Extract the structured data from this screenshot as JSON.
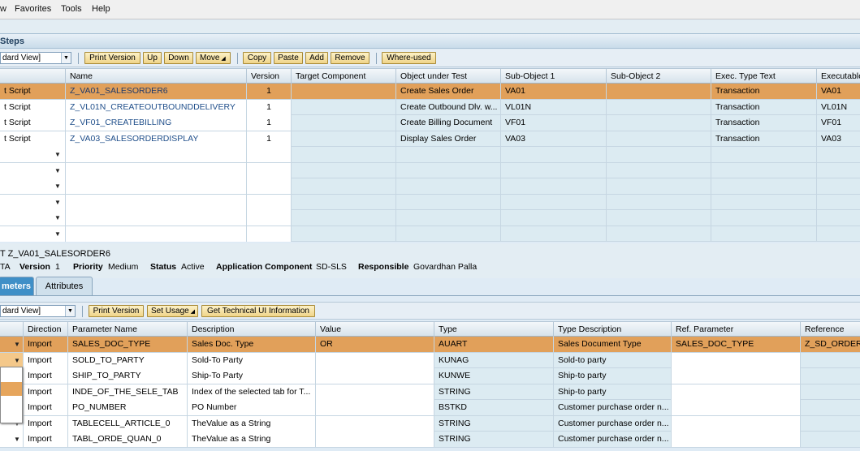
{
  "menu": [
    "w",
    "Favorites",
    "Tools",
    "Help"
  ],
  "top_section": {
    "title": "Steps",
    "layout_select": "dard View]",
    "buttons": [
      "Print Version",
      "Up",
      "Down",
      "Move",
      "Copy",
      "Paste",
      "Add",
      "Remove",
      "Where-used"
    ],
    "columns": [
      "",
      "Name",
      "Version",
      "Target Component",
      "Object under Test",
      "Sub-Object 1",
      "Sub-Object 2",
      "Exec. Type Text",
      "Executable"
    ],
    "rows": [
      {
        "type": "t Script",
        "name": "Z_VA01_SALESORDER6",
        "version": "1",
        "target": "",
        "object": "Create Sales Order",
        "sub1": "VA01",
        "sub2": "",
        "exec": "Transaction",
        "executable": "VA01"
      },
      {
        "type": "t Script",
        "name": "Z_VL01N_CREATEOUTBOUNDDELIVERY",
        "version": "1",
        "target": "",
        "object": "Create Outbound Dlv. w...",
        "sub1": "VL01N",
        "sub2": "",
        "exec": "Transaction",
        "executable": "VL01N"
      },
      {
        "type": "t Script",
        "name": "Z_VF01_CREATEBILLING",
        "version": "1",
        "target": "",
        "object": "Create Billing Document",
        "sub1": "VF01",
        "sub2": "",
        "exec": "Transaction",
        "executable": "VF01"
      },
      {
        "type": "t Script",
        "name": "Z_VA03_SALESORDERDISPLAY",
        "version": "1",
        "target": "",
        "object": "Display Sales Order",
        "sub1": "VA03",
        "sub2": "",
        "exec": "Transaction",
        "executable": "VA03"
      }
    ]
  },
  "details": {
    "title": "T Z_VA01_SALESORDER6",
    "type_frag": "TA",
    "version_label": "Version",
    "version": "1",
    "priority_label": "Priority",
    "priority": "Medium",
    "status_label": "Status",
    "status": "Active",
    "appcomp_label": "Application Component",
    "appcomp": "SD-SLS",
    "resp_label": "Responsible",
    "resp": "Govardhan Palla"
  },
  "tabs": [
    "meters",
    "Attributes"
  ],
  "param_section": {
    "layout_select": "dard View]",
    "buttons": [
      "Print Version",
      "Set Usage",
      "Get Technical UI Information"
    ],
    "columns": [
      "",
      "Direction",
      "Parameter Name",
      "Description",
      "Value",
      "Type",
      "Type Description",
      "Ref. Parameter",
      "Reference"
    ],
    "rows": [
      {
        "direction": "Import",
        "name": "SALES_DOC_TYPE",
        "desc": "Sales Doc. Type",
        "value": "OR",
        "type": "AUART",
        "typedesc": "Sales Document Type",
        "ref": "SALES_DOC_TYPE",
        "reference": "Z_SD_ORDER"
      },
      {
        "direction": "Import",
        "name": "SOLD_TO_PARTY",
        "desc": "Sold-To Party",
        "value": "",
        "type": "KUNAG",
        "typedesc": "Sold-to party",
        "ref": "",
        "reference": ""
      },
      {
        "direction": "Import",
        "name": "SHIP_TO_PARTY",
        "desc": "Ship-To Party",
        "value": "",
        "type": "KUNWE",
        "typedesc": "Ship-to party",
        "ref": "",
        "reference": ""
      },
      {
        "direction": "Import",
        "name": "INDE_OF_THE_SELE_TAB",
        "desc": "Index of the selected tab for T...",
        "value": "",
        "type": "STRING",
        "typedesc": "Ship-to party",
        "ref": "",
        "reference": ""
      },
      {
        "direction": "Import",
        "name": "PO_NUMBER",
        "desc": "PO Number",
        "value": "",
        "type": "BSTKD",
        "typedesc": "Customer purchase order n...",
        "ref": "",
        "reference": ""
      },
      {
        "direction": "Import",
        "name": "TABLECELL_ARTICLE_0",
        "desc": "TheValue as a String",
        "value": "",
        "type": "STRING",
        "typedesc": "Customer purchase order n...",
        "ref": "",
        "reference": ""
      },
      {
        "direction": "Import",
        "name": "TABL_ORDE_QUAN_0",
        "desc": "TheValue as a String",
        "value": "",
        "type": "STRING",
        "typedesc": "Customer purchase order n...",
        "ref": "",
        "reference": ""
      }
    ]
  },
  "colors": {
    "selected_row": "#e1a05a",
    "button": "#f0d489",
    "grid_bg": "#dcebf2"
  }
}
